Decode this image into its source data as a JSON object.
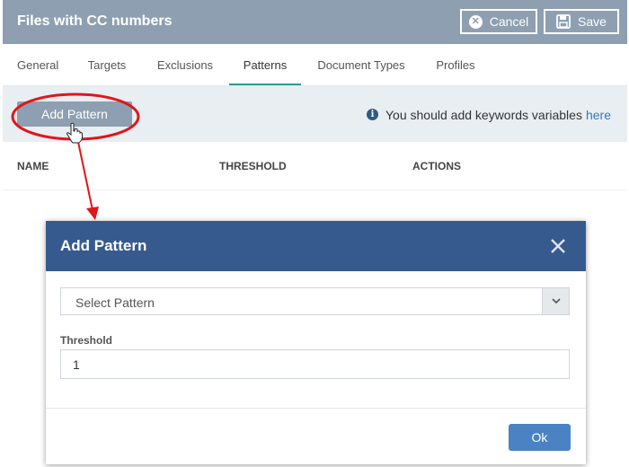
{
  "header": {
    "title": "Files with CC numbers",
    "cancel_label": "Cancel",
    "save_label": "Save"
  },
  "tabs": [
    {
      "label": "General",
      "active": false
    },
    {
      "label": "Targets",
      "active": false
    },
    {
      "label": "Exclusions",
      "active": false
    },
    {
      "label": "Patterns",
      "active": true
    },
    {
      "label": "Document Types",
      "active": false
    },
    {
      "label": "Profiles",
      "active": false
    }
  ],
  "toolbar": {
    "add_pattern_label": "Add Pattern",
    "info_text": "You should add keywords variables",
    "info_link": "here"
  },
  "table": {
    "columns": [
      "NAME",
      "THRESHOLD",
      "ACTIONS"
    ]
  },
  "dialog": {
    "title": "Add Pattern",
    "select_value": "Select Pattern",
    "threshold_label": "Threshold",
    "threshold_value": "1",
    "ok_label": "Ok"
  },
  "colors": {
    "header_bg": "#8e9fb1",
    "dialog_header_bg": "#375a8e",
    "active_tab_underline": "#2a9d8f",
    "ok_button": "#4a82c3",
    "annotation_red": "#e0161b",
    "link": "#2e7bbf"
  },
  "icons": {
    "cancel": "circle-x-icon",
    "save": "floppy-disk-icon",
    "info": "info-circle-icon",
    "close": "close-icon",
    "dropdown": "chevron-down-icon",
    "cursor": "hand-pointer-icon"
  }
}
